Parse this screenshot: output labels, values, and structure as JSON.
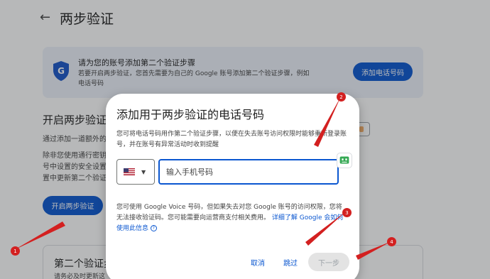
{
  "header": {
    "back_icon": "arrow-left-icon",
    "title": "两步验证"
  },
  "banner": {
    "icon": "google-shield-icon",
    "title": "请为您的账号添加第二个验证步骤",
    "desc": "若要开启两步验证，您首先需要为自己的 Google 账号添加第二个验证步骤，例如电话号码",
    "button_label": "添加电话号码"
  },
  "section": {
    "title": "开启两步验证",
    "desc_line1": "通过添加一道额外的",
    "desc_line2": "除非您使用通行密钥 号中设置的安全设置 置中更新第二个验证",
    "enable_button": "开启两步验证"
  },
  "card2": {
    "title": "第二个验证步",
    "desc": "请务必及时更新这"
  },
  "dialog": {
    "title": "添加用于两步验证的电话号码",
    "desc": "您可将电话号码用作第二个验证步骤，以便在失去账号访问权限时能够重新登录账号，并在账号有异常活动时收到提醒",
    "country_flag": "us-flag-icon",
    "phone_placeholder": "输入手机号码",
    "footer_note": "您可使用 Google Voice 号码，但如果失去对您 Google 账号的访问权限，您将无法接收验证码。您可能需要向运营商支付相关费用。",
    "learn_more": "详细了解 Google 会如何使用此信息",
    "cancel_label": "取消",
    "skip_label": "跳过",
    "next_label": "下一步"
  },
  "annotations": {
    "badges": [
      "1",
      "2",
      "3",
      "4"
    ],
    "color": "#d32020"
  },
  "colors": {
    "accent": "#0b57d0",
    "banner_bg": "#eef2fb",
    "disabled_bg": "#e3e3e3"
  }
}
